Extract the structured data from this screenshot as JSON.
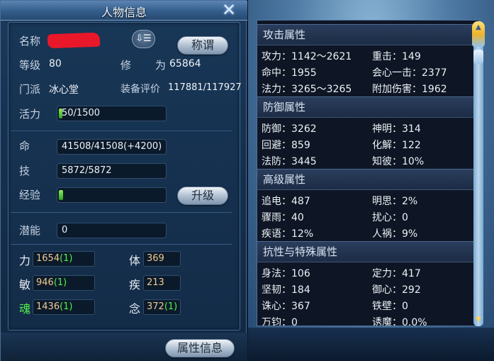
{
  "window": {
    "title": "人物信息",
    "close_label": "✕"
  },
  "profile": {
    "name_label": "名称",
    "title_button": "称谓",
    "sort_button": "⇩☰",
    "level_label": "等级",
    "level_value": "80",
    "cultivation_label_1": "修",
    "cultivation_label_2": "为",
    "cultivation_value": "65864",
    "sect_label": "门派",
    "sect_value": "冰心堂",
    "equip_label": "装备评价",
    "equip_value": "117881/117927",
    "vitality_label": "活力",
    "vitality_value": "50/1500",
    "vitality_fraction": 0.033,
    "hp_label": "命",
    "hp_value": "41508/41508(+4200)",
    "skill_label": "技",
    "skill_value": "5872/5872",
    "exp_label": "经验",
    "exp_fraction": 0.04,
    "upgrade_button": "升级",
    "potential_label": "潜能",
    "potential_value": "0"
  },
  "attributes": {
    "strength_label": "力",
    "strength_value": "1654",
    "strength_bonus": "(1)",
    "body_label": "体",
    "body_value": "369",
    "agility_label": "敏",
    "agility_value": "946",
    "agility_bonus": "(1)",
    "speed_label": "疾",
    "speed_value": "213",
    "soul_label": "魂",
    "soul_value": "1436",
    "soul_bonus": "(1)",
    "mind_label": "念",
    "mind_value": "372",
    "mind_bonus": "(1)"
  },
  "bottom": {
    "attr_info_button": "属性信息"
  },
  "stats": {
    "attack_header": "攻击属性",
    "attack": [
      "攻力：1142～2621",
      "重击：149",
      "命中：1955",
      "会心一击：2377",
      "法力：3265～3265",
      "附加伤害：1962"
    ],
    "defense_header": "防御属性",
    "defense": [
      "防御：3262",
      "神明：314",
      "回避：859",
      "化解：122",
      "法防：3445",
      "知彼：10%"
    ],
    "advanced_header": "高级属性",
    "advanced": [
      "追电：487",
      "明思：2%",
      "骤雨：40",
      "扰心：0",
      "疾语：12%",
      "人祸：9%"
    ],
    "special_header": "抗性与特殊属性",
    "special": [
      "身法：106",
      "定力：417",
      "坚韧：184",
      "御心：292",
      "诛心：367",
      "铁壁：0",
      "万钧：0",
      "诱魔：0.0%"
    ]
  },
  "colors": {
    "accent_green": "#53f048",
    "attr_value": "#f0c890",
    "redaction": "#e8182a"
  }
}
